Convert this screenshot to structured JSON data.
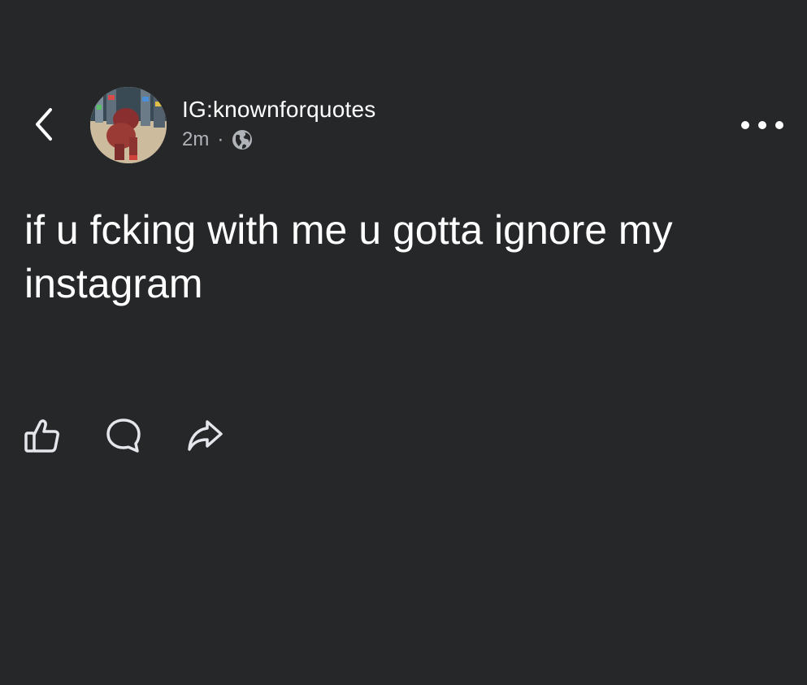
{
  "header": {
    "back_icon": "chevron-left-icon",
    "more_icon": "more-horizontal-icon"
  },
  "author": {
    "username": "IG:knownforquotes",
    "timestamp": "2m",
    "separator": "·",
    "visibility_icon": "globe-icon"
  },
  "post": {
    "text": "if u fcking with me u gotta ignore my instagram"
  },
  "actions": {
    "like_icon": "thumbs-up-icon",
    "comment_icon": "comment-bubble-icon",
    "share_icon": "share-arrow-icon"
  },
  "colors": {
    "background": "#252729",
    "primary_text": "#ffffff",
    "secondary_text": "#b0b3b8",
    "icon": "#e4e6eb"
  }
}
